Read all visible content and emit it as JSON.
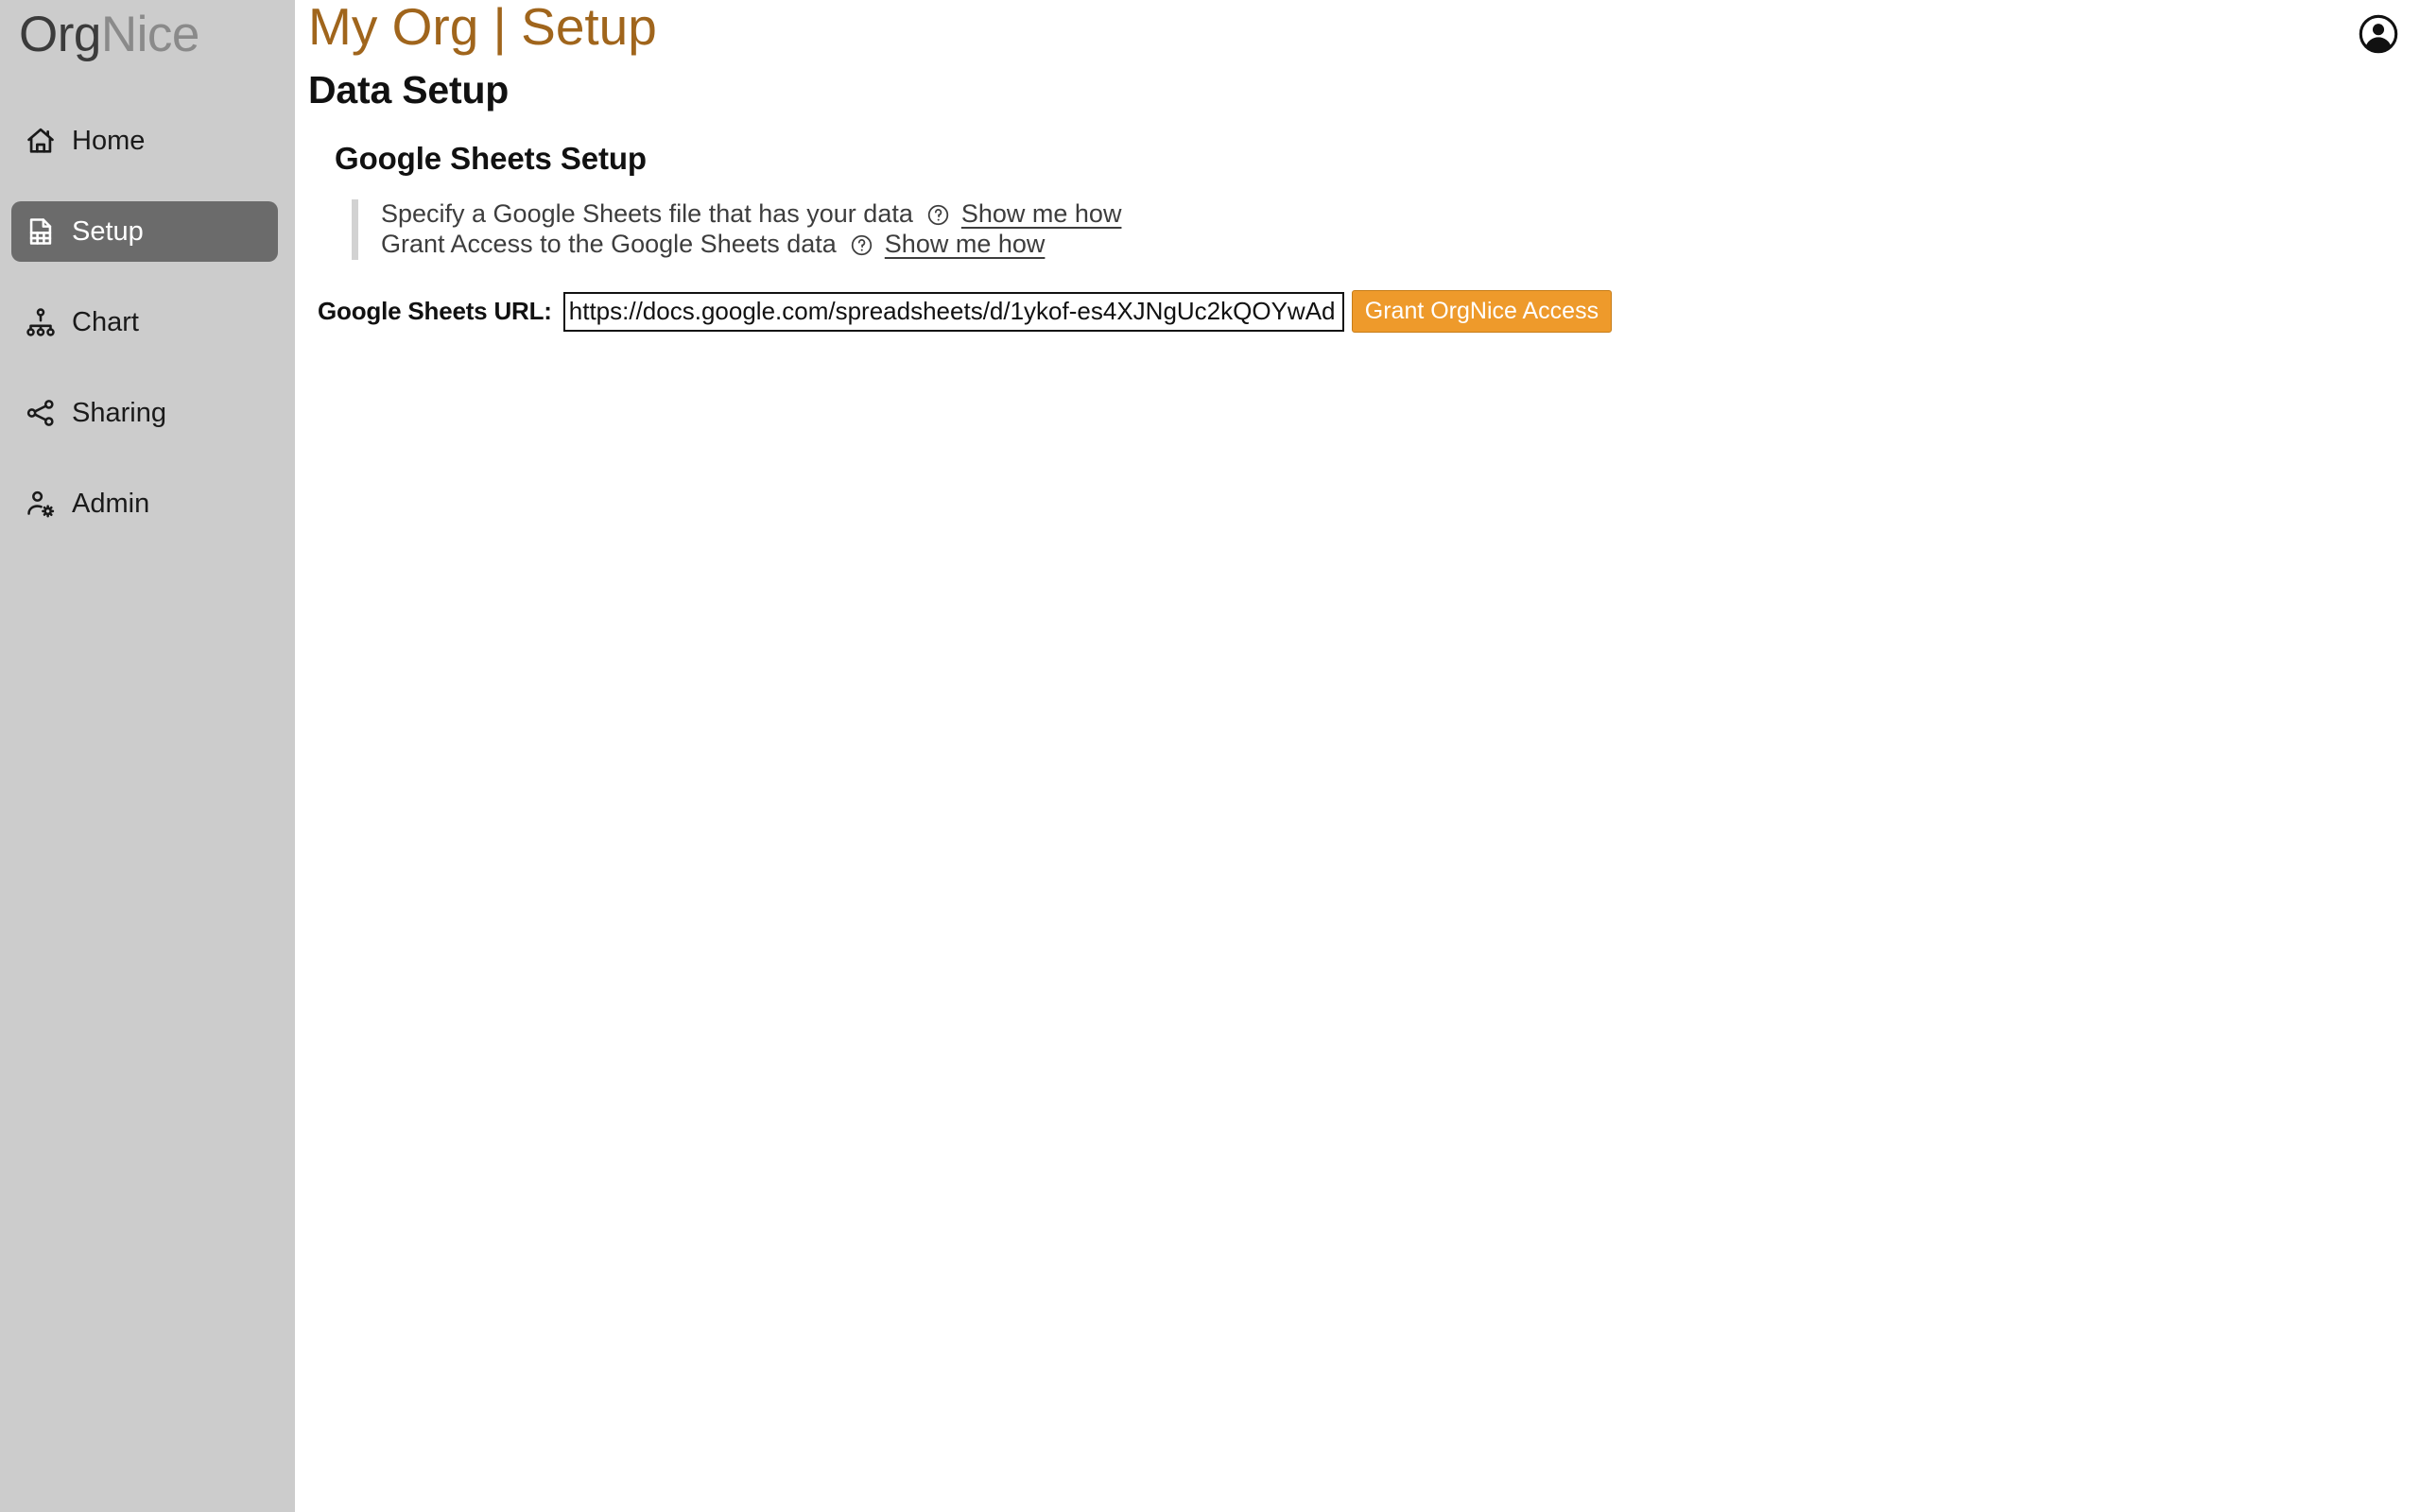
{
  "brand": {
    "primary": "Org",
    "secondary": "Nice"
  },
  "sidebar": {
    "items": [
      {
        "label": "Home",
        "icon": "home-icon",
        "active": false
      },
      {
        "label": "Setup",
        "icon": "sheet-icon",
        "active": true
      },
      {
        "label": "Chart",
        "icon": "org-tree-icon",
        "active": false
      },
      {
        "label": "Sharing",
        "icon": "share-icon",
        "active": false
      },
      {
        "label": "Admin",
        "icon": "user-gear-icon",
        "active": false
      }
    ]
  },
  "header": {
    "title": "My Org | Setup",
    "avatar_icon": "account-circle-icon"
  },
  "main": {
    "page_heading": "Data Setup",
    "section_heading": "Google Sheets Setup",
    "steps": [
      {
        "text": "Specify a Google Sheets file that has your data",
        "help_icon": "question-circle-icon",
        "link": "Show me how"
      },
      {
        "text": "Grant Access to the Google Sheets data",
        "help_icon": "question-circle-icon",
        "link": "Show me how"
      }
    ],
    "url_field": {
      "label": "Google Sheets URL:",
      "value": "https://docs.google.com/spreadsheets/d/1ykof-es4XJNgUc2kQOYwAd",
      "placeholder": ""
    },
    "grant_button": "Grant OrgNice Access"
  },
  "colors": {
    "sidebar_bg": "#cccccc",
    "active_item_bg": "#6b6b6b",
    "title_accent": "#a0651c",
    "button_orange": "#ee9a2b",
    "step_border": "#d2d2d2"
  }
}
